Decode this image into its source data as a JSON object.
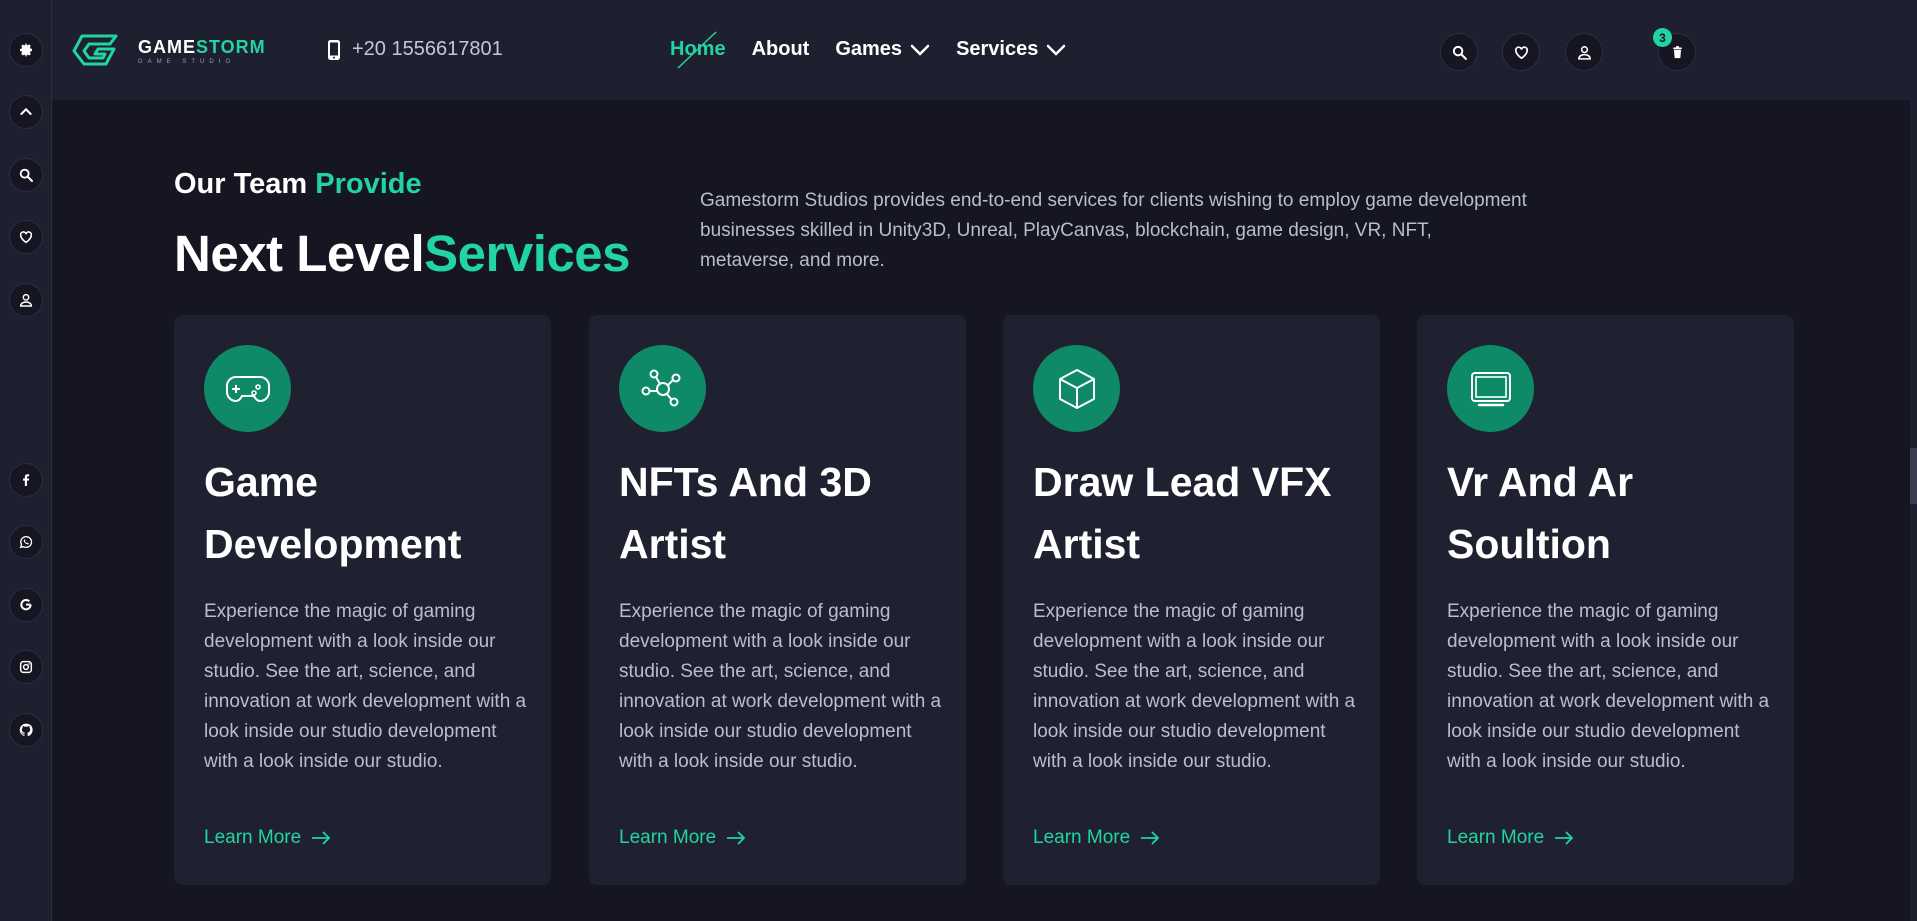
{
  "brand": {
    "name_part1": "GAME",
    "name_part2": "STORM",
    "tagline": "GAME STUDIO",
    "accent_color": "#21d4a2"
  },
  "header": {
    "phone": "+20 1556617801",
    "nav": [
      {
        "label": "Home",
        "active": true
      },
      {
        "label": "About",
        "active": false
      },
      {
        "label": "Games",
        "active": false,
        "dropdown": true
      },
      {
        "label": "Services",
        "active": false,
        "dropdown": true
      }
    ],
    "icons": [
      "search-icon",
      "heart-icon",
      "user-icon",
      "cart-icon"
    ],
    "cart_count": "3"
  },
  "sidebar": {
    "top_icons": [
      "gear-icon",
      "chevron-up-icon",
      "search-icon",
      "heart-icon",
      "user-icon"
    ],
    "social_icons": [
      "facebook-icon",
      "whatsapp-icon",
      "google-icon",
      "instagram-icon",
      "github-icon"
    ]
  },
  "hero": {
    "eyebrow_part1": "Our Team ",
    "eyebrow_part2": "Provide",
    "headline_part1": "Next Level",
    "headline_part2": "Services",
    "intro": "Gamestorm Studios provides end-to-end services for clients wishing to employ game development businesses skilled in Unity3D, Unreal, PlayCanvas, blockchain, game design, VR, NFT, metaverse, and more."
  },
  "cards": [
    {
      "icon": "gamepad-icon",
      "title": "Game Development",
      "text": "Experience the magic of gaming development with a look inside our studio. See the art, science, and innovation at work development with a look inside our studio development with a look inside our studio.",
      "link": "Learn More"
    },
    {
      "icon": "network-icon",
      "title": "NFTs And 3D Artist",
      "text": "Experience the magic of gaming development with a look inside our studio. See the art, science, and innovation at work development with a look inside our studio development with a look inside our studio.",
      "link": "Learn More"
    },
    {
      "icon": "cube-icon",
      "title": "Draw Lead VFX Artist",
      "text": "Experience the magic of gaming development with a look inside our studio. See the art, science, and innovation at work development with a look inside our studio development with a look inside our studio.",
      "link": "Learn More"
    },
    {
      "icon": "monitor-icon",
      "title": "Vr And Ar Soultion",
      "text": "Experience the magic of gaming development with a look inside our studio. See the art, science, and innovation at work development with a look inside our studio development with a look inside our studio.",
      "link": "Learn More"
    }
  ]
}
